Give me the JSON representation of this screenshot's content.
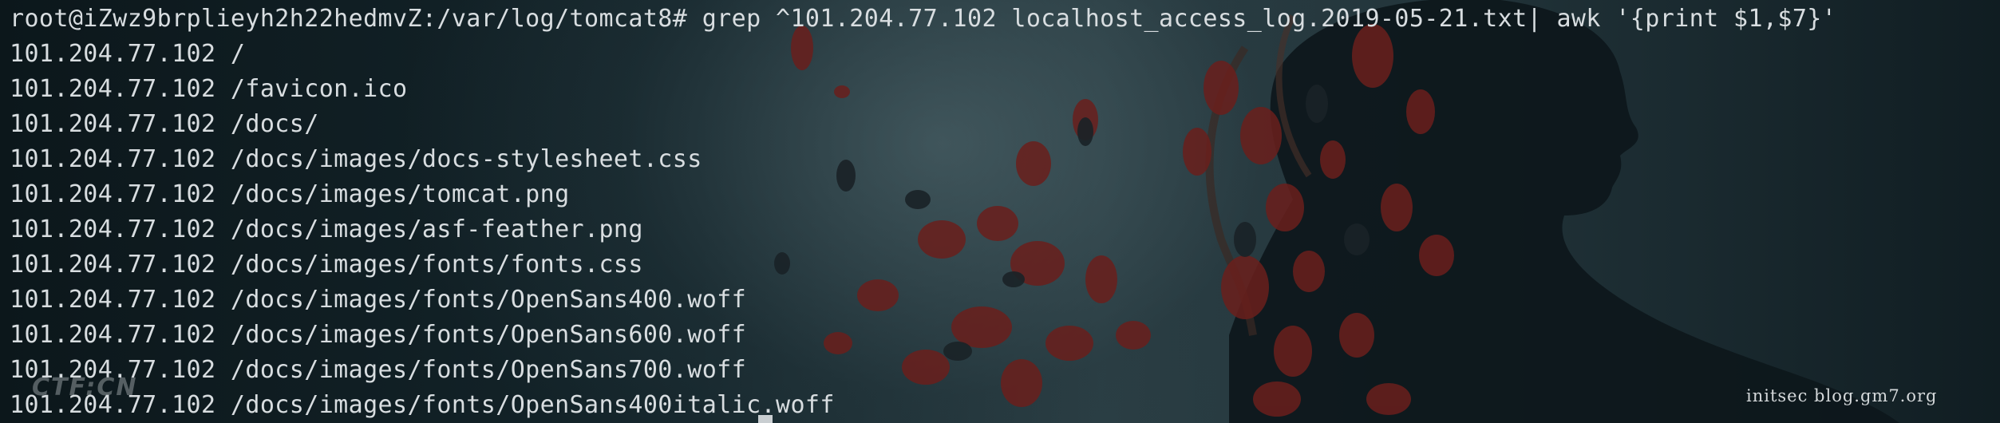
{
  "terminal": {
    "prompt": "root@iZwz9brplieyh2h22hedmvZ:/var/log/tomcat8#",
    "command": " grep ^101.204.77.102 localhost_access_log.2019-05-21.txt| awk '{print $1,$7}'",
    "output": [
      "101.204.77.102 /",
      "101.204.77.102 /favicon.ico",
      "101.204.77.102 /docs/",
      "101.204.77.102 /docs/images/docs-stylesheet.css",
      "101.204.77.102 /docs/images/tomcat.png",
      "101.204.77.102 /docs/images/asf-feather.png",
      "101.204.77.102 /docs/images/fonts/fonts.css",
      "101.204.77.102 /docs/images/fonts/OpenSans400.woff",
      "101.204.77.102 /docs/images/fonts/OpenSans600.woff",
      "101.204.77.102 /docs/images/fonts/OpenSans700.woff",
      "101.204.77.102 /docs/images/fonts/OpenSans400italic.woff"
    ]
  },
  "watermarks": {
    "left": "CTF:CN",
    "right": "initsec blog.gm7.org"
  },
  "icons": {
    "cursor": "block-cursor-icon"
  }
}
